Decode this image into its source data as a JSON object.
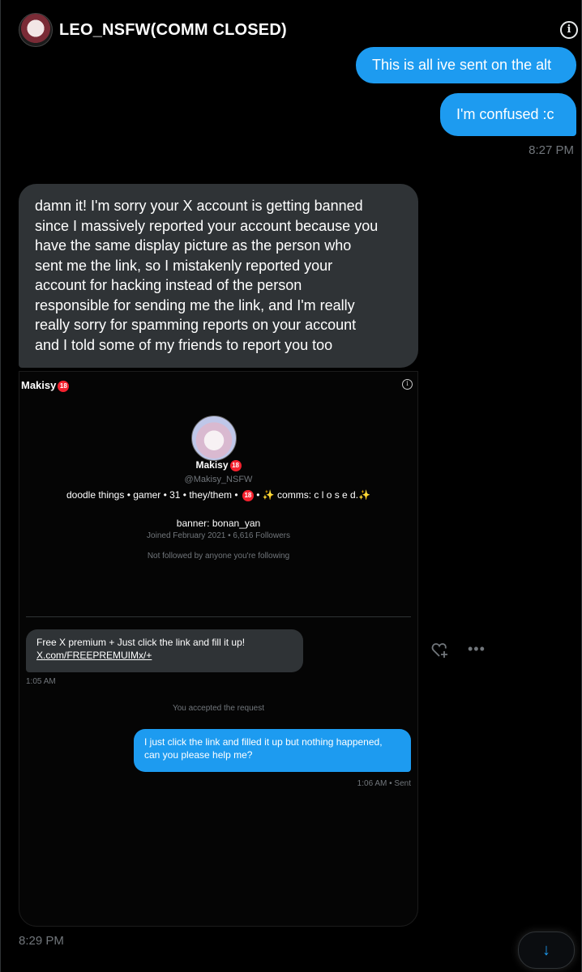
{
  "header": {
    "title": "LEO_NSFW(COMM CLOSED)",
    "info_icon": "i"
  },
  "messages": {
    "sent1": "This is all ive sent on the alt",
    "sent2": "I'm confused :c",
    "sent_time": "8:27 PM",
    "recv_lines": [
      "damn it! I'm sorry your X account is getting banned",
      "since I massively reported your account because you",
      "have the same display picture as the person who",
      "sent me the link, so I mistakenly reported your",
      "account for hacking instead  of the person",
      "responsible for sending me the link, and I'm really",
      "really sorry for spamming reports on your account",
      "and I told some of my friends to report you too"
    ],
    "recv_time": "8:29 PM"
  },
  "screenshot": {
    "name": "Makisy",
    "badge": "18",
    "profile_name": "Makisy",
    "handle": "@Makisy_NSFW",
    "bio_left": "doodle things • gamer • 31 • they/them • ",
    "bio_right": " • ✨ comms: c l o s e d.✨",
    "banner": "banner: bonan_yan",
    "joined": "Joined February 2021 • 6,616 Followers",
    "not_followed": "Not followed by anyone you're following",
    "dm_recv_line1": "Free X premium + Just click the link and fill it up!",
    "dm_recv_link": "X.com/FREEPREMUIMx/+",
    "dm_time1": "1:05 AM",
    "accepted": "You accepted the request",
    "dm_sent": "I just click the link and filled it up but nothing happened, can you please help me?",
    "dm_time2": "1:06 AM • Sent"
  },
  "icons": {
    "react": "heart-plus-icon",
    "more": "more-icon",
    "scroll": "arrow-down-icon"
  },
  "colors": {
    "sent_bubble": "#1d9bf0",
    "recv_bubble": "#2f3336",
    "background": "#000000"
  }
}
